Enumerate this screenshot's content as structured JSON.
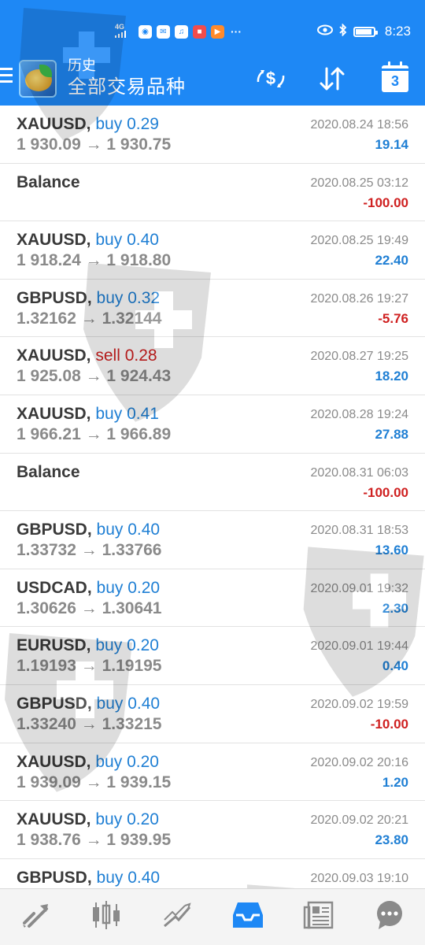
{
  "status_bar": {
    "signal_label": "4G",
    "time": "8:23",
    "battery_level": 0.92,
    "notification_icons": [
      "app-icon-1",
      "app-icon-2",
      "app-icon-3",
      "app-icon-4",
      "app-icon-5",
      "more-icon"
    ]
  },
  "toolbar": {
    "title": "历史",
    "subtitle": "全部交易品种",
    "calendar_day": "3"
  },
  "colors": {
    "header": "#1e88f5",
    "buy": "#1f7fd4",
    "sell": "#cf2020",
    "profit_positive": "#1f7fd4",
    "profit_negative": "#cf2020"
  },
  "deals": [
    {
      "symbol": "XAUUSD,",
      "type": "buy",
      "volume": "0.29",
      "prices": "1 930.09 → 1 930.75",
      "date": "2020.08.24 18:56",
      "profit": "19.14",
      "direction": "buy",
      "sign": "positive"
    },
    {
      "symbol": "Balance",
      "type": "",
      "volume": "",
      "prices": "",
      "date": "2020.08.25 03:12",
      "profit": "-100.00",
      "direction": "none",
      "sign": "negative"
    },
    {
      "symbol": "XAUUSD,",
      "type": "buy",
      "volume": "0.40",
      "prices": "1 918.24 → 1 918.80",
      "date": "2020.08.25 19:49",
      "profit": "22.40",
      "direction": "buy",
      "sign": "positive"
    },
    {
      "symbol": "GBPUSD,",
      "type": "buy",
      "volume": "0.32",
      "prices": "1.32162 → 1.32144",
      "date": "2020.08.26 19:27",
      "profit": "-5.76",
      "direction": "buy",
      "sign": "negative"
    },
    {
      "symbol": "XAUUSD,",
      "type": "sell",
      "volume": "0.28",
      "prices": "1 925.08 → 1 924.43",
      "date": "2020.08.27 19:25",
      "profit": "18.20",
      "direction": "sell",
      "sign": "positive"
    },
    {
      "symbol": "XAUUSD,",
      "type": "buy",
      "volume": "0.41",
      "prices": "1 966.21 → 1 966.89",
      "date": "2020.08.28 19:24",
      "profit": "27.88",
      "direction": "buy",
      "sign": "positive"
    },
    {
      "symbol": "Balance",
      "type": "",
      "volume": "",
      "prices": "",
      "date": "2020.08.31 06:03",
      "profit": "-100.00",
      "direction": "none",
      "sign": "negative"
    },
    {
      "symbol": "GBPUSD,",
      "type": "buy",
      "volume": "0.40",
      "prices": "1.33732 → 1.33766",
      "date": "2020.08.31 18:53",
      "profit": "13.60",
      "direction": "buy",
      "sign": "positive"
    },
    {
      "symbol": "USDCAD,",
      "type": "buy",
      "volume": "0.20",
      "prices": "1.30626 → 1.30641",
      "date": "2020.09.01 19:32",
      "profit": "2.30",
      "direction": "buy",
      "sign": "positive"
    },
    {
      "symbol": "EURUSD,",
      "type": "buy",
      "volume": "0.20",
      "prices": "1.19193 → 1.19195",
      "date": "2020.09.01 19:44",
      "profit": "0.40",
      "direction": "buy",
      "sign": "positive"
    },
    {
      "symbol": "GBPUSD,",
      "type": "buy",
      "volume": "0.40",
      "prices": "1.33240 → 1.33215",
      "date": "2020.09.02 19:59",
      "profit": "-10.00",
      "direction": "buy",
      "sign": "negative"
    },
    {
      "symbol": "XAUUSD,",
      "type": "buy",
      "volume": "0.20",
      "prices": "1 939.09 → 1 939.15",
      "date": "2020.09.02 20:16",
      "profit": "1.20",
      "direction": "buy",
      "sign": "positive"
    },
    {
      "symbol": "XAUUSD,",
      "type": "buy",
      "volume": "0.20",
      "prices": "1 938.76 → 1 939.95",
      "date": "2020.09.02 20:21",
      "profit": "23.80",
      "direction": "buy",
      "sign": "positive"
    },
    {
      "symbol": "GBPUSD,",
      "type": "buy",
      "volume": "0.40",
      "prices": "",
      "date": "2020.09.03 19:10",
      "profit": "",
      "direction": "buy",
      "sign": "positive"
    }
  ],
  "bottom_nav": [
    {
      "icon": "quotes-icon",
      "active": false
    },
    {
      "icon": "chart-icon",
      "active": false
    },
    {
      "icon": "trade-icon",
      "active": false
    },
    {
      "icon": "history-icon",
      "active": true
    },
    {
      "icon": "news-icon",
      "active": false
    },
    {
      "icon": "chat-icon",
      "active": false
    }
  ]
}
